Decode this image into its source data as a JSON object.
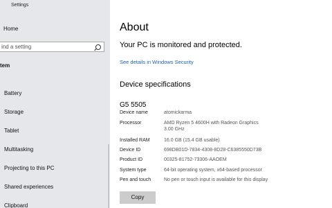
{
  "window": {
    "title": "Settings"
  },
  "sidebar": {
    "home_label": "Home",
    "search_placeholder": "ind a setting",
    "section_label": "tem",
    "items": [
      {
        "label": "Battery"
      },
      {
        "label": "Storage"
      },
      {
        "label": "Tablet"
      },
      {
        "label": "Multitasking"
      },
      {
        "label": "Projecting to this PC"
      },
      {
        "label": "Shared experiences"
      },
      {
        "label": "Clipboard"
      }
    ]
  },
  "main": {
    "title": "About",
    "protected_text": "Your PC is monitored and protected.",
    "security_link": "See details in Windows Security",
    "device_specs_heading": "Device specifications",
    "model": "G5 5505",
    "specs": [
      {
        "key": "Device name",
        "value": "atomickarma"
      },
      {
        "key": "Processor",
        "value": "AMD Ryzen 5 4600H with Radeon Graphics",
        "value2": "3.00 GHz"
      },
      {
        "key": "Installed RAM",
        "value": "16.0 GB (15.4 GB usable)"
      },
      {
        "key": "Device ID",
        "value": "698DB01D-7834-4308-8D28-C6385550D73B"
      },
      {
        "key": "Product ID",
        "value": "00325-81752-73306-AAOEM"
      },
      {
        "key": "System type",
        "value": "64-bit operating system, x64-based processor"
      },
      {
        "key": "Pen and touch",
        "value": "No pen or touch input is available for this display"
      }
    ],
    "copy_button": "Copy"
  }
}
